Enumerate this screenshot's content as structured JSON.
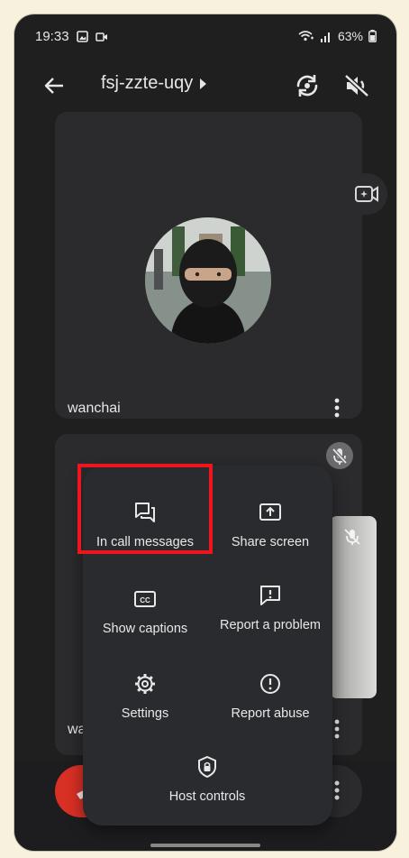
{
  "status_bar": {
    "time": "19:33",
    "battery": "63%",
    "icons": [
      "image-icon",
      "video-record-icon",
      "wifi-calling-icon",
      "signal-icon",
      "battery-icon"
    ]
  },
  "app_bar": {
    "meeting_code": "fsj-zzte-uqy"
  },
  "participants": [
    {
      "name": "wanchai"
    },
    {
      "name_visible_fragment": "wa"
    }
  ],
  "overflow_menu": {
    "items": [
      {
        "label": "In call messages",
        "icon": "chat-bubbles-icon",
        "highlighted": true
      },
      {
        "label": "Share screen",
        "icon": "share-screen-icon"
      },
      {
        "label": "Show captions",
        "icon": "closed-captions-icon"
      },
      {
        "label": "Report a problem",
        "icon": "report-problem-icon"
      },
      {
        "label": "Settings",
        "icon": "gear-icon"
      },
      {
        "label": "Report abuse",
        "icon": "exclamation-circle-icon"
      },
      {
        "label": "Host controls",
        "icon": "host-controls-shield-icon"
      }
    ]
  },
  "colors": {
    "highlight": "#f0141e",
    "end_call": "#d93025",
    "background": "#1f1f20",
    "menu_background": "#2a2b2f"
  }
}
